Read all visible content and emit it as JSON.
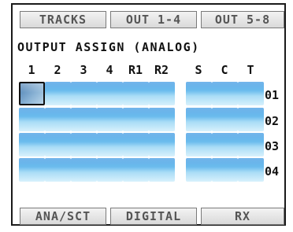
{
  "tabs": {
    "tracks": "TRACKS",
    "out_1_4": "OUT 1-4",
    "out_5_8": "OUT 5-8"
  },
  "title": "OUTPUT ASSIGN (ANALOG)",
  "columns": [
    "1",
    "2",
    "3",
    "4",
    "R1",
    "R2",
    "S",
    "C",
    "T"
  ],
  "rows": [
    "01",
    "02",
    "03",
    "04"
  ],
  "selected_cell": {
    "row": "01",
    "column": "1"
  },
  "bottom_buttons": {
    "ana_sct": "ANA/SCT",
    "digital": "DIGITAL",
    "rx": "RX"
  },
  "colors": {
    "cell_blue": "#2a8ee0",
    "cell_light": "#d8f1fc",
    "selected_fill": "#6f9ccc",
    "frame": "#1a1a1a"
  }
}
